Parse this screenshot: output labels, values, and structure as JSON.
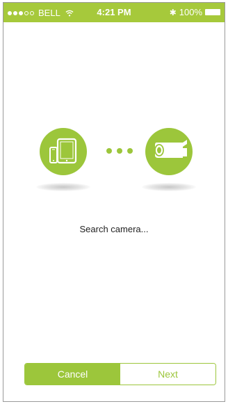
{
  "status_bar": {
    "carrier": "BELL",
    "time": "4:21 PM",
    "battery": "100%"
  },
  "main": {
    "status_text": "Search camera..."
  },
  "buttons": {
    "cancel_label": "Cancel",
    "next_label": "Next"
  },
  "colors": {
    "accent": "#9cc63b",
    "status_bar": "#a6c93b"
  },
  "icons": [
    "wifi-icon",
    "bluetooth-icon",
    "battery-icon",
    "devices-icon",
    "connection-dots-icon",
    "camera-icon"
  ]
}
